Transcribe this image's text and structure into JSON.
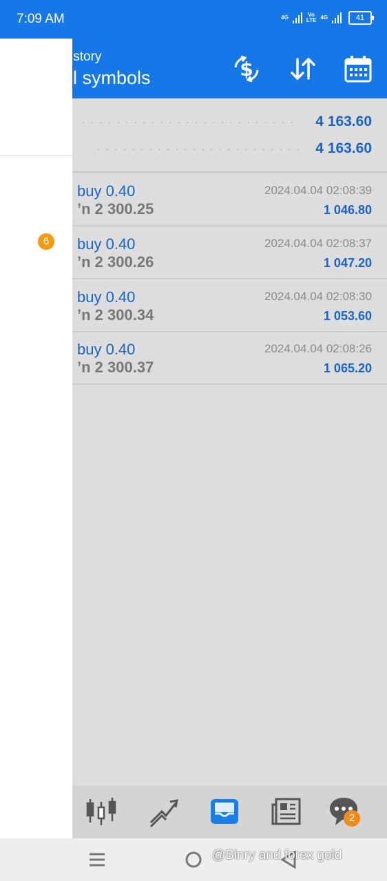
{
  "status_bar": {
    "time": "7:09 AM",
    "signal1_label": "4G",
    "volte_label_top": "Vo",
    "volte_label_bottom": "LTE",
    "signal2_label": "4G",
    "battery": "41"
  },
  "toolbar": {
    "subtitle": "istory",
    "title": "ll symbols",
    "icons": [
      "currency-swap-icon",
      "sort-icon",
      "calendar-icon"
    ]
  },
  "summary": [
    {
      "value": "4 163.60"
    },
    {
      "value": "4 163.60"
    }
  ],
  "drawer": {
    "badge": "6"
  },
  "deals": [
    {
      "action": "buy 0.40",
      "price": "’n  2 300.25",
      "date": "2024.04.04 02:08:39",
      "profit": "1 046.80"
    },
    {
      "action": "buy 0.40",
      "price": "’n  2 300.26",
      "date": "2024.04.04 02:08:37",
      "profit": "1 047.20"
    },
    {
      "action": "buy 0.40",
      "price": "’n  2 300.34",
      "date": "2024.04.04 02:08:30",
      "profit": "1 053.60"
    },
    {
      "action": "buy 0.40",
      "price": "’n  2 300.37",
      "date": "2024.04.04 02:08:26",
      "profit": "1 065.20"
    }
  ],
  "bottom_tabs": {
    "items": [
      "quotes-icon",
      "chart-icon",
      "trade-inbox-icon",
      "news-icon",
      "chat-icon"
    ],
    "active": "trade-inbox-icon",
    "chat_badge": "2"
  },
  "nav_bar": {
    "watermark": "@Binry and forex gold"
  },
  "colors": {
    "accent": "#1578e6",
    "value_blue": "#1a63c7",
    "badge_orange": "#f39c12"
  }
}
